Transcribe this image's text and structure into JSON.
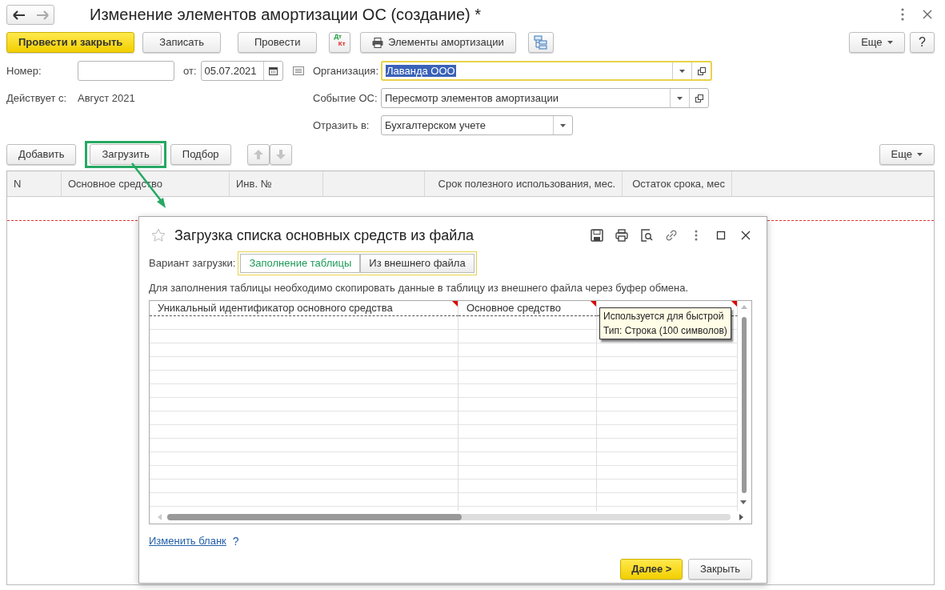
{
  "window": {
    "title": "Изменение элементов амортизации ОС (создание) *"
  },
  "toolbar": {
    "buttons": [
      {
        "kind": "primary",
        "label": "Провести и закрыть"
      },
      {
        "kind": "plain",
        "label": "Записать"
      },
      {
        "kind": "plain",
        "label": "Провести"
      },
      {
        "kind": "dtkt",
        "top": "Дт",
        "bottom": "Кт"
      },
      {
        "kind": "print",
        "label": "Элементы амортизации"
      },
      {
        "kind": "structure"
      }
    ],
    "more": "Еще",
    "help": "?"
  },
  "form": {
    "number_label": "Номер:",
    "date_label": "от:",
    "date": "05.07.2021",
    "effective_label": "Действует с:",
    "effective_value": "Август 2021",
    "fields": [
      {
        "label": "Организация:",
        "value": "Лаванда ООО",
        "focused": true,
        "open_button": true
      },
      {
        "label": "Событие ОС:",
        "value": "Пересмотр элементов амортизации",
        "focused": false,
        "open_button": true
      },
      {
        "label": "Отразить в:",
        "value": "Бухгалтерском учете",
        "focused": false,
        "open_button": false
      }
    ]
  },
  "table": {
    "buttons": [
      {
        "label": "Добавить",
        "highlighted": false
      },
      {
        "label": "Загрузить",
        "highlighted": true
      },
      {
        "label": "Подбор",
        "highlighted": false
      }
    ],
    "more": "Еще",
    "columns": [
      {
        "kind": "text",
        "label": "N"
      },
      {
        "kind": "text",
        "label": "Основное средство"
      },
      {
        "kind": "text",
        "label": "Инв. №"
      },
      {
        "kind": "blank"
      },
      {
        "kind": "right",
        "label": "Срок полезного использования, мес."
      },
      {
        "kind": "right",
        "label": "Остаток срока, мес"
      }
    ]
  },
  "dialog": {
    "title": "Загрузка списка основных средств из файла",
    "variant_label": "Вариант загрузки:",
    "variants": [
      {
        "label": "Заполнение таблицы",
        "selected": true
      },
      {
        "label": "Из внешнего файла",
        "selected": false
      }
    ],
    "hint": "Для заполнения таблицы необходимо скопировать данные в таблицу из внешнего файла через буфер обмена.",
    "grid_columns": [
      {
        "label": "Уникальный идентификатор основного средства"
      },
      {
        "label": "Основное средство"
      }
    ],
    "tooltip": [
      "Используется для быстрой",
      "Тип: Строка (100 символов)"
    ],
    "link": "Изменить бланк",
    "help": "?",
    "buttons": [
      {
        "kind": "primary",
        "label": "Далее >"
      },
      {
        "kind": "plain",
        "label": "Закрыть"
      }
    ]
  }
}
